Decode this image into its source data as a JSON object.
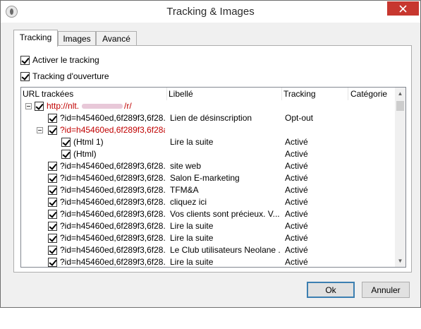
{
  "window": {
    "title": "Tracking & Images"
  },
  "tabs": [
    {
      "label": "Tracking",
      "active": true
    },
    {
      "label": "Images",
      "active": false
    },
    {
      "label": "Avancé",
      "active": false
    }
  ],
  "options": {
    "activer_tracking": {
      "label": "Activer le tracking",
      "checked": true
    },
    "tracking_ouverture": {
      "label": "Tracking d'ouverture",
      "checked": true
    }
  },
  "tree": {
    "columns": {
      "url": "URL trackées",
      "label": "Libellé",
      "tracking": "Tracking",
      "category": "Catégorie"
    },
    "rows": [
      {
        "url": "http://nlt.",
        "url_suffix": "/r/",
        "label": "",
        "tracking": "",
        "level": 0,
        "expander": true,
        "red": true
      },
      {
        "url": "?id=h45460ed,6f289f3,6f28...",
        "label": "Lien de désinscription",
        "tracking": "Opt-out",
        "level": 1,
        "expander": false,
        "red": false
      },
      {
        "url": "?id=h45460ed,6f289f3,6f28a...",
        "label": "",
        "tracking": "",
        "level": 1,
        "expander": true,
        "red": true
      },
      {
        "url": "(Html 1)",
        "label": "Lire la suite",
        "tracking": "Activé",
        "level": 2,
        "expander": false,
        "red": false
      },
      {
        "url": "(Html)",
        "label": "",
        "tracking": "Activé",
        "level": 2,
        "expander": false,
        "red": false
      },
      {
        "url": "?id=h45460ed,6f289f3,6f28...",
        "label": "site web",
        "tracking": "Activé",
        "level": 1,
        "expander": false,
        "red": false
      },
      {
        "url": "?id=h45460ed,6f289f3,6f28...",
        "label": "Salon E-marketing",
        "tracking": "Activé",
        "level": 1,
        "expander": false,
        "red": false
      },
      {
        "url": "?id=h45460ed,6f289f3,6f28...",
        "label": "TFM&A",
        "tracking": "Activé",
        "level": 1,
        "expander": false,
        "red": false
      },
      {
        "url": "?id=h45460ed,6f289f3,6f28...",
        "label": "cliquez ici",
        "tracking": "Activé",
        "level": 1,
        "expander": false,
        "red": false
      },
      {
        "url": "?id=h45460ed,6f289f3,6f28...",
        "label": " Vos clients sont précieux. V...",
        "tracking": "Activé",
        "level": 1,
        "expander": false,
        "red": false
      },
      {
        "url": "?id=h45460ed,6f289f3,6f28...",
        "label": "Lire la suite",
        "tracking": "Activé",
        "level": 1,
        "expander": false,
        "red": false
      },
      {
        "url": "?id=h45460ed,6f289f3,6f28...",
        "label": "Lire la suite",
        "tracking": "Activé",
        "level": 1,
        "expander": false,
        "red": false
      },
      {
        "url": "?id=h45460ed,6f289f3,6f28...",
        "label": "Le Club utilisateurs Neolane ...",
        "tracking": "Activé",
        "level": 1,
        "expander": false,
        "red": false
      },
      {
        "url": "?id=h45460ed,6f289f3,6f28...",
        "label": "Lire la suite",
        "tracking": "Activé",
        "level": 1,
        "expander": false,
        "red": false
      }
    ]
  },
  "buttons": {
    "ok": "Ok",
    "cancel": "Annuler"
  },
  "icons": {
    "app": "app-icon",
    "close": "close-icon",
    "scroll_up": "scroll-up-icon",
    "scroll_down": "scroll-down-icon"
  },
  "colors": {
    "close_button": "#c7372f",
    "link_red": "#c00000",
    "default_button_border": "#3c7fb1"
  }
}
